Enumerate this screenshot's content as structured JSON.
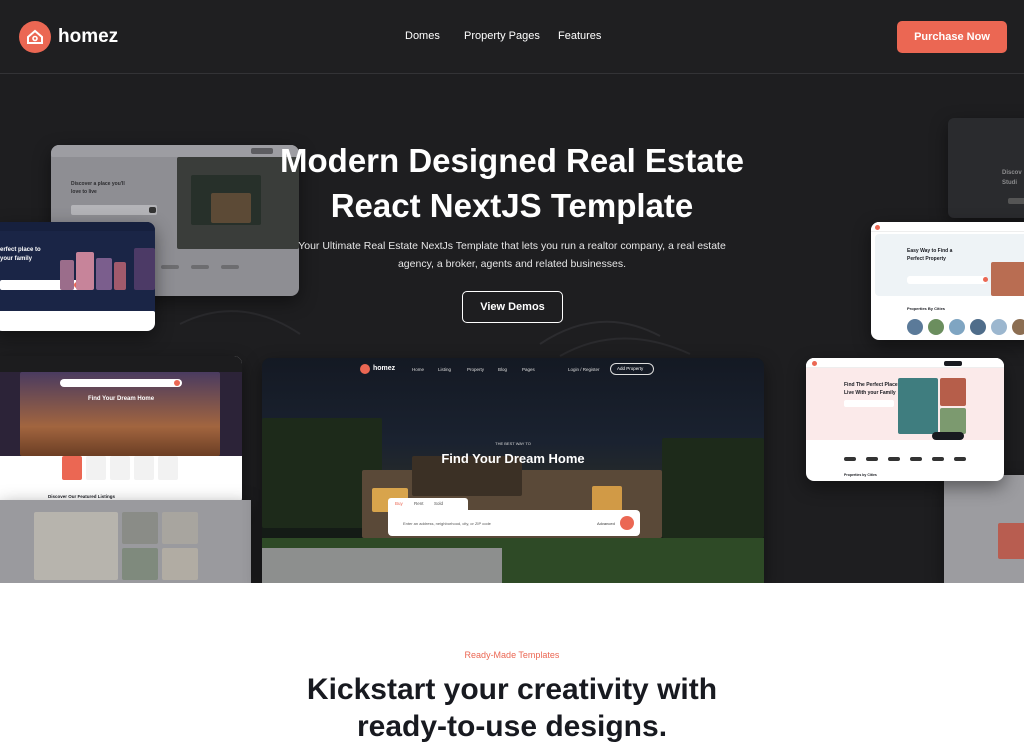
{
  "header": {
    "brand": "homez",
    "nav": [
      "Domes",
      "Property Pages",
      "Features"
    ],
    "cta": "Purchase Now"
  },
  "hero": {
    "title_line1": "Modern Designed Real Estate",
    "title_line2": "React NextJS Template",
    "lead_line1": "Your Ultimate Real Estate NextJs Template that lets you run a realtor company, a real estate",
    "lead_line2": "agency, a broker, agents and related businesses.",
    "button": "View Demos"
  },
  "mockups": {
    "left_top": {
      "heading_line1": "Discover a place you'll",
      "heading_line2": "love to live"
    },
    "left_mid": {
      "heading_line1": "erfect place to",
      "heading_line2": "your family"
    },
    "left_bottom": {
      "title": "Find Your Dream Home",
      "section": "Discover Our Featured Listings"
    },
    "center": {
      "brand": "homez",
      "menu": [
        "Home",
        "Listing",
        "Property",
        "Blog",
        "Pages"
      ],
      "login": "Login / Register",
      "add": "Add Property",
      "eyebrow": "THE BEST WAY TO",
      "title": "Find Your Dream Home",
      "tabs": [
        "Buy",
        "Rent",
        "Sold"
      ],
      "search_placeholder": "Enter an address, neighborhood, city, or ZIP code",
      "advanced": "Advanced"
    },
    "right_top": {
      "heading_line1": "Easy Way to Find a",
      "heading_line2": "Perfect Property",
      "section": "Properties By Cities"
    },
    "right_mid": {
      "heading_line1": "Find The Perfect Place to",
      "heading_line2": "Live With your Family",
      "section": "Properties by Cities"
    },
    "right_edge": {
      "heading_line1": "Discov",
      "heading_line2": "Studi"
    }
  },
  "section": {
    "eyebrow": "Ready-Made Templates",
    "title_line1": "Kickstart your creativity with",
    "title_line2": "ready-to-use designs."
  },
  "colors": {
    "accent": "#eb6753",
    "dark": "#1e1e20",
    "text_dark": "#181a20"
  }
}
